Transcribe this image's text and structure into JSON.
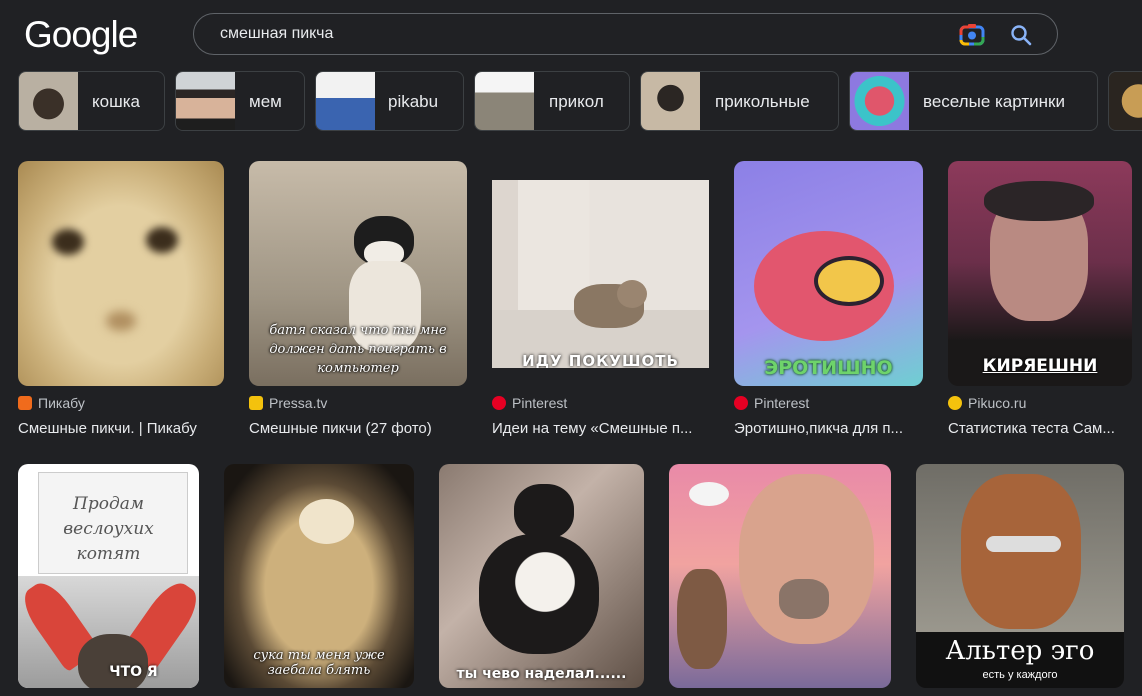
{
  "header": {
    "logo": "Google",
    "query": "смешная пикча"
  },
  "chips": [
    {
      "label": "кошка"
    },
    {
      "label": "мем"
    },
    {
      "label": "pikabu"
    },
    {
      "label": "прикол"
    },
    {
      "label": "прикольные"
    },
    {
      "label": "веселые картинки"
    }
  ],
  "results": [
    {
      "source": "Пикабу",
      "title": "Смешные пикчи. | Пикабу",
      "fav_color": "#f06b1c"
    },
    {
      "source": "Pressa.tv",
      "title": "Смешные пикчи (27 фото)",
      "fav_color": "#f4c20d",
      "caption": "батя сказал что ты мне должен дать поиграть в компьютер"
    },
    {
      "source": "Pinterest",
      "title": "Идеи на тему «Смешные п...",
      "fav_color": "#e60023",
      "caption": "ИДУ ПОКУШОТЬ"
    },
    {
      "source": "Pinterest",
      "title": "Эротишно,пикча для п...",
      "fav_color": "#e60023",
      "caption": "ЭРОТИШНО"
    },
    {
      "source": "Pikuco.ru",
      "title": "Статистика теста Сам...",
      "fav_color": "#f4c20d",
      "caption": "КИРЯЕШНИ"
    }
  ],
  "row2": [
    {
      "caption": "Продам веслоухих котят",
      "caption2": "ЧТО Я"
    },
    {
      "caption": "сука ты меня уже заебала блять"
    },
    {
      "caption": "ты чево наделал......"
    },
    {},
    {
      "caption": "Альтер эго",
      "caption2": "есть у каждого"
    }
  ],
  "colors": {
    "background": "#202124",
    "border": "#3c4043",
    "text": "#e8eaed",
    "muted": "#bdc1c6"
  }
}
